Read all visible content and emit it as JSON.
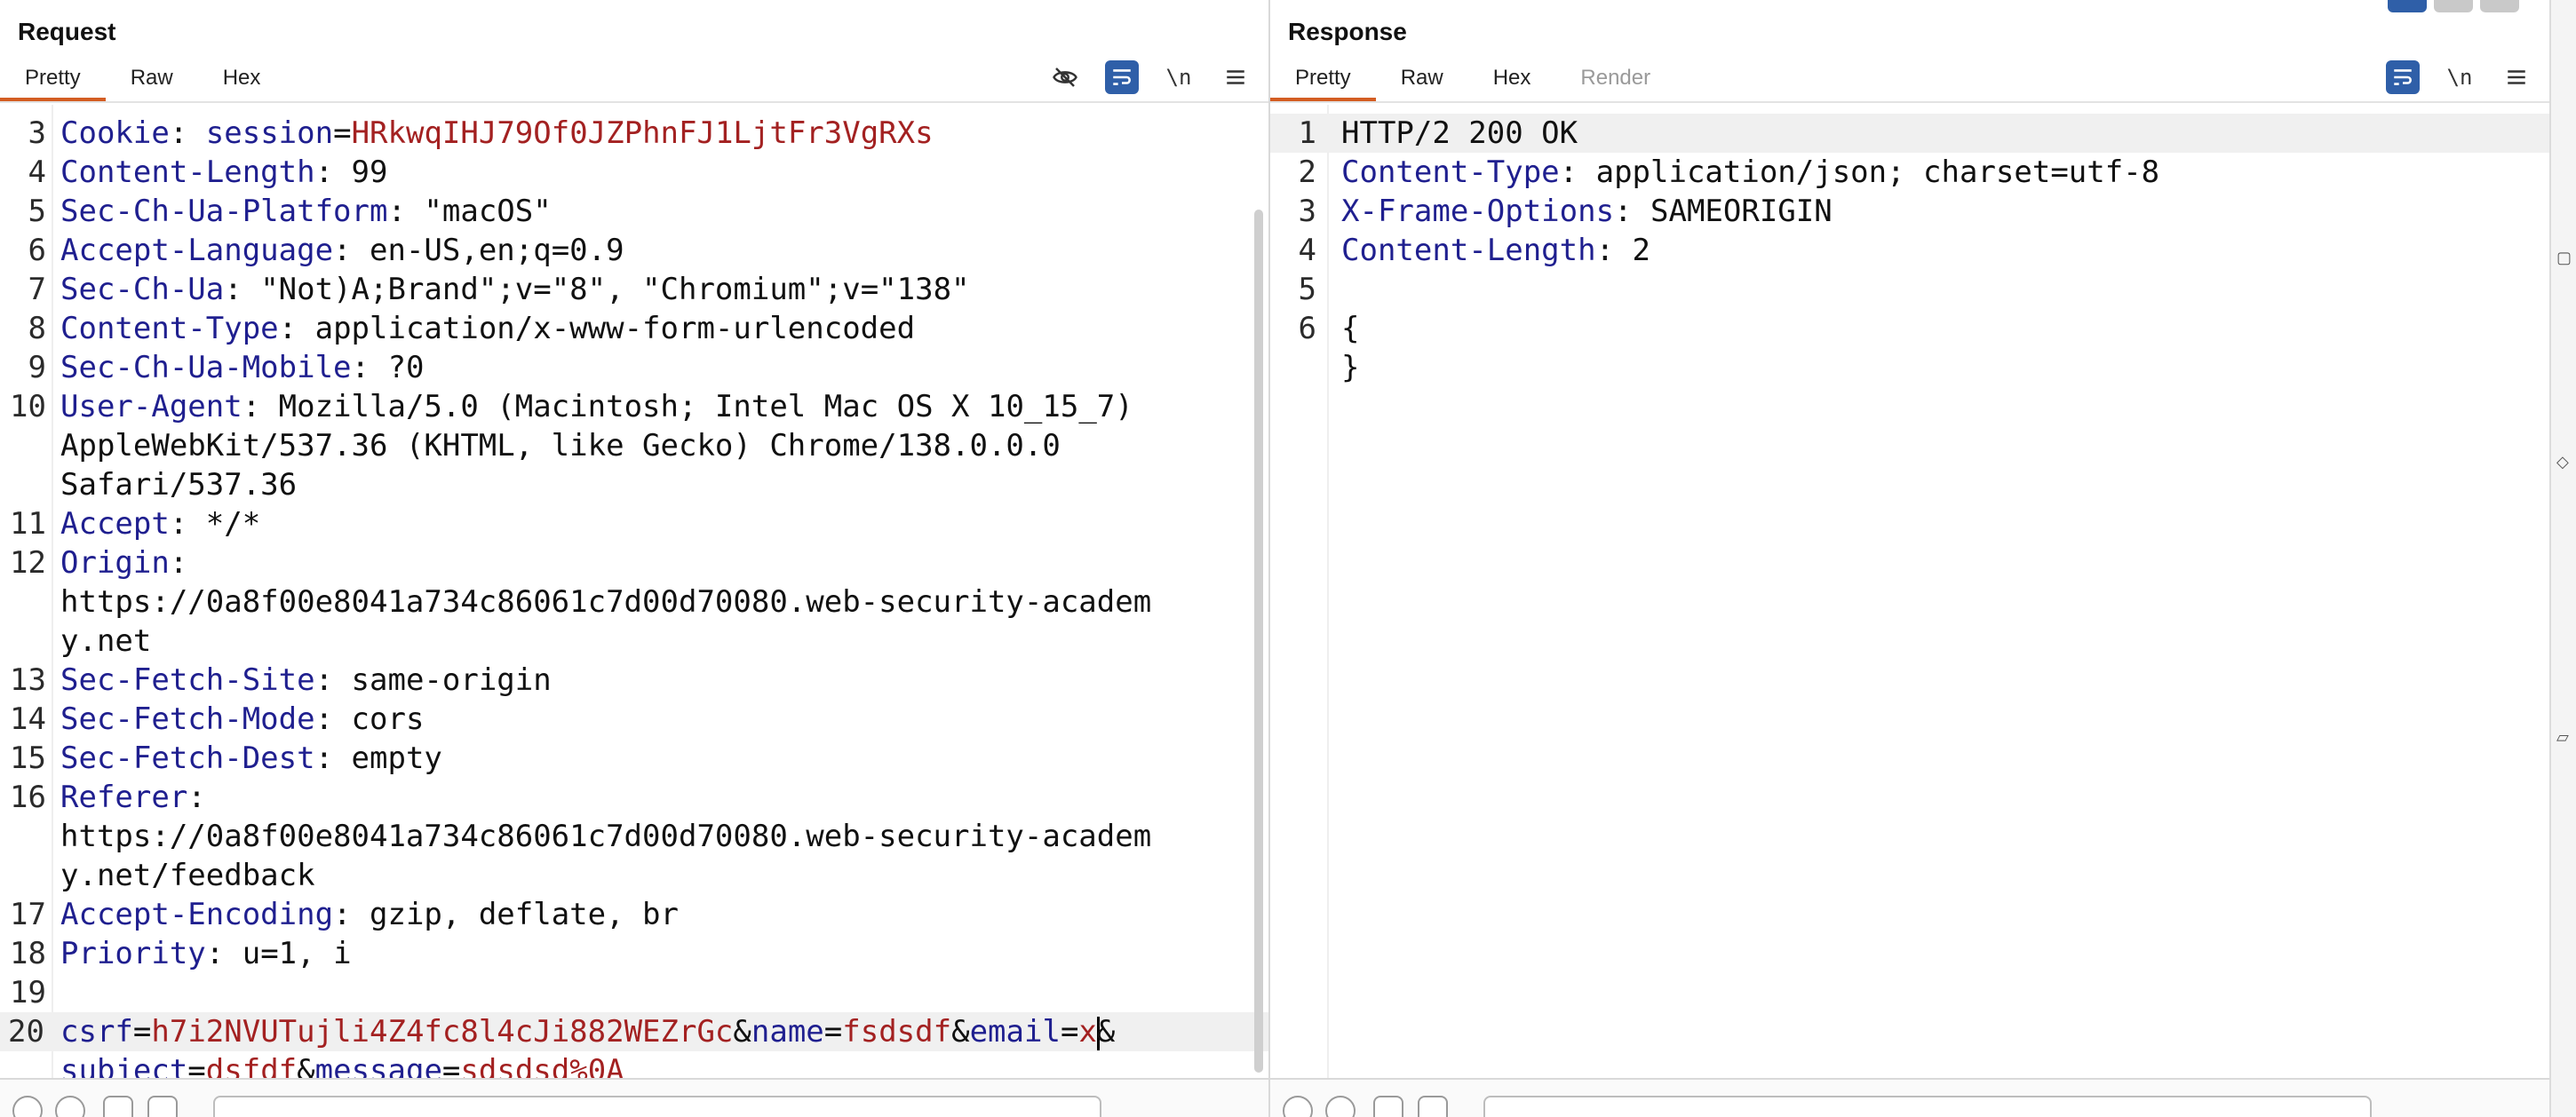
{
  "request": {
    "title": "Request",
    "tabs": [
      {
        "label": "Pretty",
        "active": true
      },
      {
        "label": "Raw"
      },
      {
        "label": "Hex"
      }
    ],
    "toolbar": {
      "hide_icon": "eye-slash-icon",
      "wrap_icon": "word-wrap-icon",
      "newline_label": "\\n",
      "menu_icon": "hamburger-menu-icon"
    },
    "lines": [
      {
        "n": "3",
        "k": "Cookie",
        "sep": ": ",
        "v_key": "session",
        "eq": "=",
        "v_val": "HRkwqIHJ79Of0JZPhnFJ1LjtFr3VgRXs"
      },
      {
        "n": "4",
        "k": "Content-Length",
        "sep": ": ",
        "v": "99"
      },
      {
        "n": "5",
        "k": "Sec-Ch-Ua-Platform",
        "sep": ": ",
        "v": "\"macOS\""
      },
      {
        "n": "6",
        "k": "Accept-Language",
        "sep": ": ",
        "v": "en-US,en;q=0.9"
      },
      {
        "n": "7",
        "k": "Sec-Ch-Ua",
        "sep": ": ",
        "v": "\"Not)A;Brand\";v=\"8\", \"Chromium\";v=\"138\""
      },
      {
        "n": "8",
        "k": "Content-Type",
        "sep": ": ",
        "v": "application/x-www-form-urlencoded"
      },
      {
        "n": "9",
        "k": "Sec-Ch-Ua-Mobile",
        "sep": ": ",
        "v": "?0"
      },
      {
        "n": "10",
        "k": "User-Agent",
        "sep": ": ",
        "v": "Mozilla/5.0 (Macintosh; Intel Mac OS X 10_15_7)"
      },
      {
        "n": "",
        "v": "AppleWebKit/537.36 (KHTML, like Gecko) Chrome/138.0.0.0"
      },
      {
        "n": "",
        "v": "Safari/537.36"
      },
      {
        "n": "11",
        "k": "Accept",
        "sep": ": ",
        "v": "*/*"
      },
      {
        "n": "12",
        "k": "Origin",
        "sep": ":",
        "v": ""
      },
      {
        "n": "",
        "v": "https://0a8f00e8041a734c86061c7d00d70080.web-security-academ"
      },
      {
        "n": "",
        "v": "y.net"
      },
      {
        "n": "13",
        "k": "Sec-Fetch-Site",
        "sep": ": ",
        "v": "same-origin"
      },
      {
        "n": "14",
        "k": "Sec-Fetch-Mode",
        "sep": ": ",
        "v": "cors"
      },
      {
        "n": "15",
        "k": "Sec-Fetch-Dest",
        "sep": ": ",
        "v": "empty"
      },
      {
        "n": "16",
        "k": "Referer",
        "sep": ":",
        "v": ""
      },
      {
        "n": "",
        "v": "https://0a8f00e8041a734c86061c7d00d70080.web-security-academ"
      },
      {
        "n": "",
        "v": "y.net/feedback"
      },
      {
        "n": "17",
        "k": "Accept-Encoding",
        "sep": ": ",
        "v": "gzip, deflate, br"
      },
      {
        "n": "18",
        "k": "Priority",
        "sep": ": ",
        "v": "u=1, i"
      },
      {
        "n": "19",
        "v": ""
      }
    ],
    "body_line_number": "20",
    "body_params_line1": [
      {
        "k": "csrf",
        "v": "h7i2NVUTujli4Z4fc8l4cJi882WEZrGc",
        "amp": "&"
      },
      {
        "k": "name",
        "v": "fsdsdf",
        "amp": "&"
      },
      {
        "k": "email",
        "v": "x",
        "amp": "&",
        "caret": true
      }
    ],
    "body_params_line2": [
      {
        "k": "subject",
        "v": "dsfdf",
        "amp": "&"
      },
      {
        "k": "message",
        "v": "sdsdsd%0A",
        "amp": ""
      }
    ]
  },
  "response": {
    "title": "Response",
    "tabs": [
      {
        "label": "Pretty",
        "active": true
      },
      {
        "label": "Raw"
      },
      {
        "label": "Hex"
      },
      {
        "label": "Render",
        "disabled": true
      }
    ],
    "toolbar": {
      "wrap_icon": "word-wrap-icon",
      "newline_label": "\\n",
      "menu_icon": "hamburger-menu-icon"
    },
    "lines": [
      {
        "n": "1",
        "v": "HTTP/2 200 OK",
        "status": true
      },
      {
        "n": "2",
        "k": "Content-Type",
        "sep": ": ",
        "v": "application/json; charset=utf-8"
      },
      {
        "n": "3",
        "k": "X-Frame-Options",
        "sep": ": ",
        "v": "SAMEORIGIN"
      },
      {
        "n": "4",
        "k": "Content-Length",
        "sep": ": ",
        "v": "2"
      },
      {
        "n": "5",
        "v": ""
      },
      {
        "n": "6",
        "v": "{"
      },
      {
        "n": "",
        "v": "}"
      }
    ]
  }
}
